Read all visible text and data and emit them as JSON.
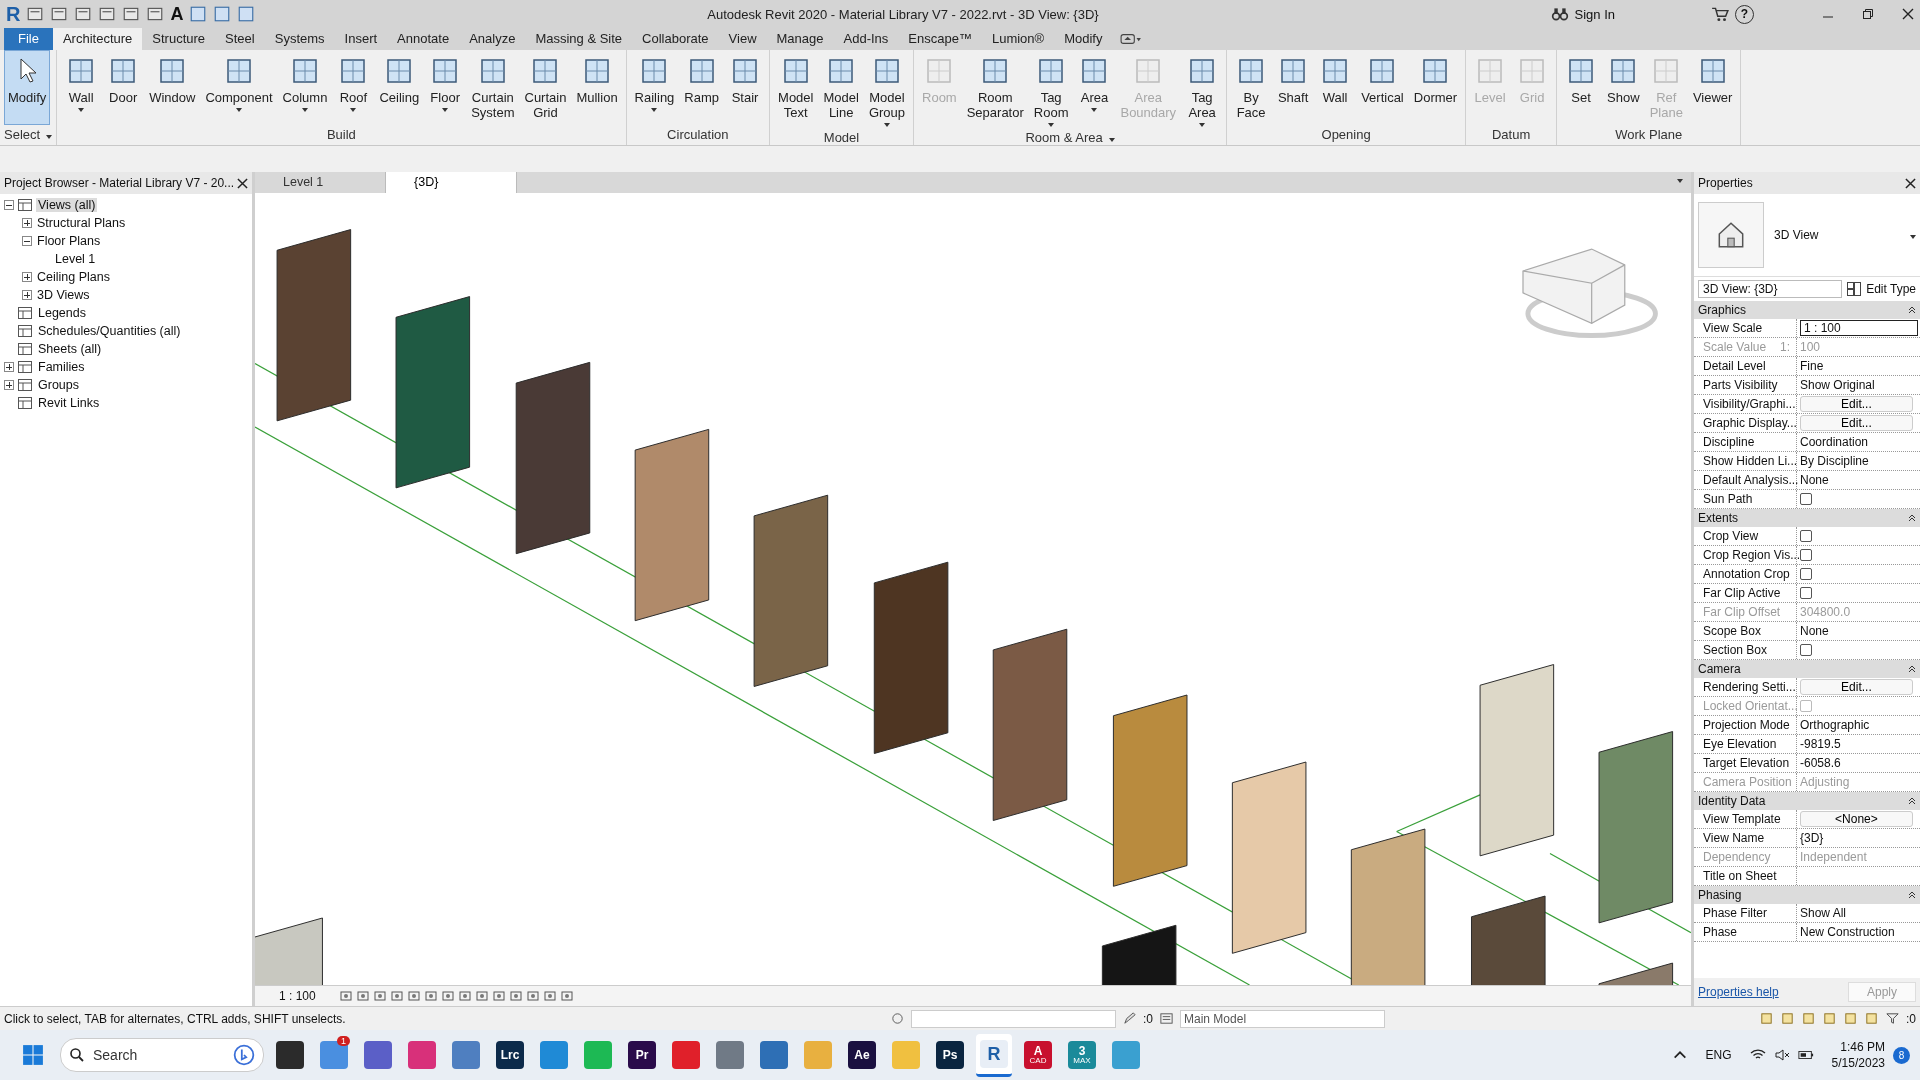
{
  "title_bar": {
    "logo": "R",
    "text_tool": "A",
    "title": "Autodesk Revit 2020 - Material Library V7 - 2022.rvt - 3D View: {3D}",
    "sign_in": "Sign In",
    "help": "?"
  },
  "menu_tabs": [
    {
      "label": "File",
      "kind": "file",
      "selected": false
    },
    {
      "label": "Architecture",
      "kind": "tab",
      "selected": true
    },
    {
      "label": "Structure",
      "kind": "tab",
      "selected": false
    },
    {
      "label": "Steel",
      "kind": "tab",
      "selected": false
    },
    {
      "label": "Systems",
      "kind": "tab",
      "selected": false
    },
    {
      "label": "Insert",
      "kind": "tab",
      "selected": false
    },
    {
      "label": "Annotate",
      "kind": "tab",
      "selected": false
    },
    {
      "label": "Analyze",
      "kind": "tab",
      "selected": false
    },
    {
      "label": "Massing & Site",
      "kind": "tab",
      "selected": false
    },
    {
      "label": "Collaborate",
      "kind": "tab",
      "selected": false
    },
    {
      "label": "View",
      "kind": "tab",
      "selected": false
    },
    {
      "label": "Manage",
      "kind": "tab",
      "selected": false
    },
    {
      "label": "Add-Ins",
      "kind": "tab",
      "selected": false
    },
    {
      "label": "Enscape™",
      "kind": "tab",
      "selected": false
    },
    {
      "label": "Lumion®",
      "kind": "tab",
      "selected": false
    },
    {
      "label": "Modify",
      "kind": "tab",
      "selected": false
    }
  ],
  "ribbon_panels": [
    {
      "name": "Select",
      "dropdown": true,
      "tools": [
        {
          "label": "Modify",
          "selected": true,
          "disabled": false,
          "dropdown": false
        }
      ]
    },
    {
      "name": "Build",
      "dropdown": false,
      "tools": [
        {
          "label": "Wall",
          "selected": false,
          "disabled": false,
          "dropdown": true
        },
        {
          "label": "Door",
          "selected": false,
          "disabled": false,
          "dropdown": false
        },
        {
          "label": "Window",
          "selected": false,
          "disabled": false,
          "dropdown": false
        },
        {
          "label": "Component",
          "selected": false,
          "disabled": false,
          "dropdown": true
        },
        {
          "label": "Column",
          "selected": false,
          "disabled": false,
          "dropdown": true
        },
        {
          "label": "Roof",
          "selected": false,
          "disabled": false,
          "dropdown": true
        },
        {
          "label": "Ceiling",
          "selected": false,
          "disabled": false,
          "dropdown": false
        },
        {
          "label": "Floor",
          "selected": false,
          "disabled": false,
          "dropdown": true
        },
        {
          "label": "Curtain System",
          "selected": false,
          "disabled": false,
          "dropdown": false
        },
        {
          "label": "Curtain Grid",
          "selected": false,
          "disabled": false,
          "dropdown": false
        },
        {
          "label": "Mullion",
          "selected": false,
          "disabled": false,
          "dropdown": false
        }
      ]
    },
    {
      "name": "Circulation",
      "dropdown": false,
      "tools": [
        {
          "label": "Railing",
          "selected": false,
          "disabled": false,
          "dropdown": true
        },
        {
          "label": "Ramp",
          "selected": false,
          "disabled": false,
          "dropdown": false
        },
        {
          "label": "Stair",
          "selected": false,
          "disabled": false,
          "dropdown": false
        }
      ]
    },
    {
      "name": "Model",
      "dropdown": false,
      "tools": [
        {
          "label": "Model Text",
          "selected": false,
          "disabled": false,
          "dropdown": false
        },
        {
          "label": "Model Line",
          "selected": false,
          "disabled": false,
          "dropdown": false
        },
        {
          "label": "Model Group",
          "selected": false,
          "disabled": false,
          "dropdown": true
        }
      ]
    },
    {
      "name": "Room & Area",
      "dropdown": true,
      "tools": [
        {
          "label": "Room",
          "selected": false,
          "disabled": true,
          "dropdown": false
        },
        {
          "label": "Room Separator",
          "selected": false,
          "disabled": false,
          "dropdown": false
        },
        {
          "label": "Tag Room",
          "selected": false,
          "disabled": false,
          "dropdown": true
        },
        {
          "label": "Area",
          "selected": false,
          "disabled": false,
          "dropdown": true
        },
        {
          "label": "Area Boundary",
          "selected": false,
          "disabled": true,
          "dropdown": false
        },
        {
          "label": "Tag Area",
          "selected": false,
          "disabled": false,
          "dropdown": true
        }
      ]
    },
    {
      "name": "Opening",
      "dropdown": false,
      "tools": [
        {
          "label": "By Face",
          "selected": false,
          "disabled": false,
          "dropdown": false
        },
        {
          "label": "Shaft",
          "selected": false,
          "disabled": false,
          "dropdown": false
        },
        {
          "label": "Wall",
          "selected": false,
          "disabled": false,
          "dropdown": false
        },
        {
          "label": "Vertical",
          "selected": false,
          "disabled": false,
          "dropdown": false
        },
        {
          "label": "Dormer",
          "selected": false,
          "disabled": false,
          "dropdown": false
        }
      ]
    },
    {
      "name": "Datum",
      "dropdown": false,
      "tools": [
        {
          "label": "Level",
          "selected": false,
          "disabled": true,
          "dropdown": false
        },
        {
          "label": "Grid",
          "selected": false,
          "disabled": true,
          "dropdown": false
        }
      ]
    },
    {
      "name": "Work Plane",
      "dropdown": false,
      "tools": [
        {
          "label": "Set",
          "selected": false,
          "disabled": false,
          "dropdown": false
        },
        {
          "label": "Show",
          "selected": false,
          "disabled": false,
          "dropdown": false
        },
        {
          "label": "Ref Plane",
          "selected": false,
          "disabled": true,
          "dropdown": false
        },
        {
          "label": "Viewer",
          "selected": false,
          "disabled": false,
          "dropdown": false
        }
      ]
    }
  ],
  "project_browser": {
    "title": "Project Browser - Material Library V7 - 20...",
    "tree": [
      {
        "label": "Views (all)",
        "expanded": true,
        "selected": true,
        "children": [
          {
            "label": "Structural Plans",
            "expanded": false,
            "selected": false
          },
          {
            "label": "Floor Plans",
            "expanded": true,
            "selected": false,
            "children": [
              {
                "label": "Level 1",
                "selected": false
              }
            ]
          },
          {
            "label": "Ceiling Plans",
            "expanded": false,
            "selected": false
          },
          {
            "label": "3D Views",
            "expanded": false,
            "selected": false
          }
        ]
      },
      {
        "label": "Legends",
        "selected": false
      },
      {
        "label": "Schedules/Quantities (all)",
        "selected": false
      },
      {
        "label": "Sheets (all)",
        "selected": false
      },
      {
        "label": "Families",
        "expanded": false,
        "selected": false
      },
      {
        "label": "Groups",
        "expanded": false,
        "selected": false
      },
      {
        "label": "Revit Links",
        "selected": false
      }
    ]
  },
  "view_tabs": [
    {
      "label": "Level 1",
      "selected": false
    },
    {
      "label": "{3D}",
      "selected": true
    }
  ],
  "view_control_bar": {
    "scale": "1 : 100"
  },
  "properties": {
    "title": "Properties",
    "type_name": "3D View",
    "instance": "3D View: {3D}",
    "edit_type": "Edit Type",
    "groups": [
      {
        "name": "Graphics",
        "rows": [
          {
            "label": "View Scale",
            "value": "1 : 100",
            "kind": "field",
            "disabled": false
          },
          {
            "label": "Scale Value",
            "suffix": "1:",
            "value": "100",
            "kind": "text",
            "disabled": true
          },
          {
            "label": "Detail Level",
            "value": "Fine",
            "kind": "text",
            "disabled": false
          },
          {
            "label": "Parts Visibility",
            "value": "Show Original",
            "kind": "text",
            "disabled": false
          },
          {
            "label": "Visibility/Graphi...",
            "value": "Edit...",
            "kind": "button",
            "disabled": false
          },
          {
            "label": "Graphic Display...",
            "value": "Edit...",
            "kind": "button",
            "disabled": false
          },
          {
            "label": "Discipline",
            "value": "Coordination",
            "kind": "text",
            "disabled": false
          },
          {
            "label": "Show Hidden Li...",
            "value": "By Discipline",
            "kind": "text",
            "disabled": false
          },
          {
            "label": "Default Analysis...",
            "value": "None",
            "kind": "text",
            "disabled": false
          },
          {
            "label": "Sun Path",
            "kind": "checkbox",
            "checked": false,
            "disabled": false
          }
        ]
      },
      {
        "name": "Extents",
        "rows": [
          {
            "label": "Crop View",
            "kind": "checkbox",
            "checked": false,
            "disabled": false
          },
          {
            "label": "Crop Region Vis...",
            "kind": "checkbox",
            "checked": false,
            "disabled": false
          },
          {
            "label": "Annotation Crop",
            "kind": "checkbox",
            "checked": false,
            "disabled": false
          },
          {
            "label": "Far Clip Active",
            "kind": "checkbox",
            "checked": false,
            "disabled": false
          },
          {
            "label": "Far Clip Offset",
            "value": "304800.0",
            "kind": "text",
            "disabled": true
          },
          {
            "label": "Scope Box",
            "value": "None",
            "kind": "text",
            "disabled": false
          },
          {
            "label": "Section Box",
            "kind": "checkbox",
            "checked": false,
            "disabled": false
          }
        ]
      },
      {
        "name": "Camera",
        "rows": [
          {
            "label": "Rendering Setti...",
            "value": "Edit...",
            "kind": "button",
            "disabled": false
          },
          {
            "label": "Locked Orientat...",
            "kind": "checkbox",
            "checked": false,
            "disabled": true
          },
          {
            "label": "Projection Mode",
            "value": "Orthographic",
            "kind": "text",
            "disabled": false
          },
          {
            "label": "Eye Elevation",
            "value": "-9819.5",
            "kind": "text",
            "disabled": false
          },
          {
            "label": "Target Elevation",
            "value": "-6058.6",
            "kind": "text",
            "disabled": false
          },
          {
            "label": "Camera Position",
            "value": "Adjusting",
            "kind": "text",
            "disabled": true
          }
        ]
      },
      {
        "name": "Identity Data",
        "rows": [
          {
            "label": "View Template",
            "value": "<None>",
            "kind": "button",
            "disabled": false
          },
          {
            "label": "View Name",
            "value": "{3D}",
            "kind": "text",
            "disabled": false
          },
          {
            "label": "Dependency",
            "value": "Independent",
            "kind": "text",
            "disabled": true
          },
          {
            "label": "Title on Sheet",
            "kind": "text",
            "disabled": false
          }
        ]
      },
      {
        "name": "Phasing",
        "rows": [
          {
            "label": "Phase Filter",
            "value": "Show All",
            "kind": "text",
            "disabled": false
          },
          {
            "label": "Phase",
            "value": "New Construction",
            "kind": "text",
            "disabled": false
          }
        ]
      }
    ],
    "help": "Properties help",
    "apply": "Apply",
    "apply_disabled": true
  },
  "status_bar": {
    "message": "Click to select, TAB for alternates, CTRL adds, SHIFT unselects.",
    "workset_count": ":0",
    "model": "Main Model",
    "filter_count": ":0"
  },
  "taskbar": {
    "search": "Search",
    "apps": [
      {
        "color": "#2b2b2b",
        "active": false
      },
      {
        "color": "#4a8fe0",
        "badge": "1",
        "active": false
      },
      {
        "color": "#5b5fc7",
        "active": false
      },
      {
        "color": "#d8307a",
        "active": false
      },
      {
        "color": "#4f7fc0",
        "active": false
      },
      {
        "label": "Lrc",
        "color": "#0c2a4a",
        "active": false
      },
      {
        "color": "#1f8ad6",
        "active": false
      },
      {
        "color": "#1db954",
        "active": false
      },
      {
        "label": "Pr",
        "color": "#2a0b4a",
        "active": false
      },
      {
        "color": "#e0202a",
        "active": false
      },
      {
        "color": "#707a86",
        "active": false
      },
      {
        "color": "#2e6fb5",
        "active": false
      },
      {
        "color": "#e8b040",
        "active": false
      },
      {
        "label": "Ae",
        "color": "#1a1040",
        "active": false
      },
      {
        "color": "#f0c040",
        "active": false
      },
      {
        "label": "Ps",
        "color": "#0a2540",
        "active": false
      },
      {
        "label": "R",
        "color": "#e8eef6",
        "active": true
      },
      {
        "label": "A",
        "sub": "CAD",
        "color": "#c8102e",
        "active": false
      },
      {
        "label": "3",
        "sub": "MAX",
        "color": "#1a8a9a",
        "active": false
      },
      {
        "color": "#3aa0d0",
        "active": false
      }
    ],
    "language": "ENG",
    "time": "1:46 PM",
    "date": "5/15/2023",
    "notifications": "8"
  }
}
